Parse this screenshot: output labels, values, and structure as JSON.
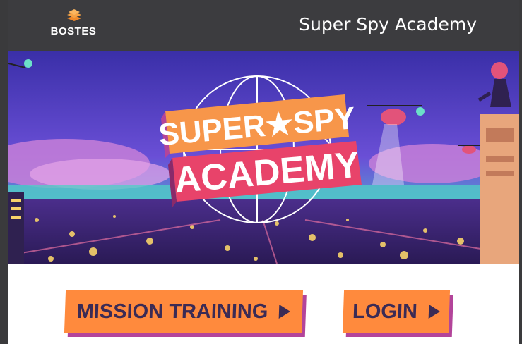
{
  "header": {
    "logo_text": "BOSTES",
    "title": "Super Spy Academy"
  },
  "hero": {
    "title_line1": "SUPER★SPY",
    "title_line2": "ACADEMY"
  },
  "buttons": {
    "mission_training": "MISSION TRAINING",
    "login": "LOGIN"
  },
  "colors": {
    "header_bg": "#3c3c3f",
    "button_bg": "#ff8a3d",
    "button_shadow": "#b3449a",
    "button_text": "#3b2b55"
  }
}
